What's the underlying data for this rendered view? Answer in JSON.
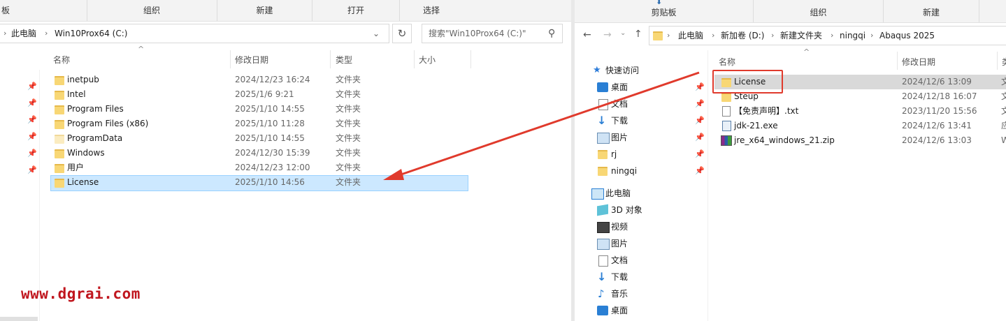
{
  "left": {
    "ribbon": [
      "板",
      "组织",
      "新建",
      "打开",
      "选择"
    ],
    "address": {
      "crumbs": [
        "此电脑",
        "Win10Prox64 (C:)"
      ]
    },
    "search": {
      "placeholder": "搜索\"Win10Prox64 (C:)\""
    },
    "columns": [
      "名称",
      "修改日期",
      "类型",
      "大小"
    ],
    "rows": [
      {
        "name": "inetpub",
        "date": "2024/12/23 16:24",
        "type": "文件夹"
      },
      {
        "name": "Intel",
        "date": "2025/1/6 9:21",
        "type": "文件夹"
      },
      {
        "name": "Program Files",
        "date": "2025/1/10 14:55",
        "type": "文件夹"
      },
      {
        "name": "Program Files (x86)",
        "date": "2025/1/10 11:28",
        "type": "文件夹"
      },
      {
        "name": "ProgramData",
        "date": "2025/1/10 14:55",
        "type": "文件夹"
      },
      {
        "name": "Windows",
        "date": "2024/12/30 15:39",
        "type": "文件夹"
      },
      {
        "name": "用户",
        "date": "2024/12/23 12:00",
        "type": "文件夹"
      },
      {
        "name": "License",
        "date": "2025/1/10 14:56",
        "type": "文件夹"
      }
    ]
  },
  "right": {
    "ribbon": [
      "剪贴板",
      "组织",
      "新建"
    ],
    "address": {
      "crumbs": [
        "此电脑",
        "新加卷 (D:)",
        "新建文件夹",
        "ningqi",
        "Abaqus 2025"
      ]
    },
    "columns": [
      "名称",
      "修改日期"
    ],
    "sidebar": {
      "quick_access": "快速访问",
      "quick_items": [
        "桌面",
        "文档",
        "下载",
        "图片",
        "rj",
        "ningqi"
      ],
      "this_pc": "此电脑",
      "pc_items": [
        "3D 对象",
        "视频",
        "图片",
        "文档",
        "下载",
        "音乐",
        "桌面"
      ]
    },
    "rows": [
      {
        "name": "License",
        "date": "2024/12/6 13:09",
        "extra": "文"
      },
      {
        "name": "Steup",
        "date": "2024/12/18 16:07",
        "extra": "文"
      },
      {
        "name": "【免责声明】.txt",
        "date": "2023/11/20 15:56",
        "extra": "文"
      },
      {
        "name": "jdk-21.exe",
        "date": "2024/12/6 13:41",
        "extra": "应"
      },
      {
        "name": "jre_x64_windows_21.zip",
        "date": "2024/12/6 13:03",
        "extra": "W"
      }
    ]
  },
  "watermark": "www.dgrai.com",
  "colors": {
    "selected_bg": "#cce8ff",
    "highlight_red": "#e03a2c",
    "folder_yellow": "#f8d775"
  }
}
